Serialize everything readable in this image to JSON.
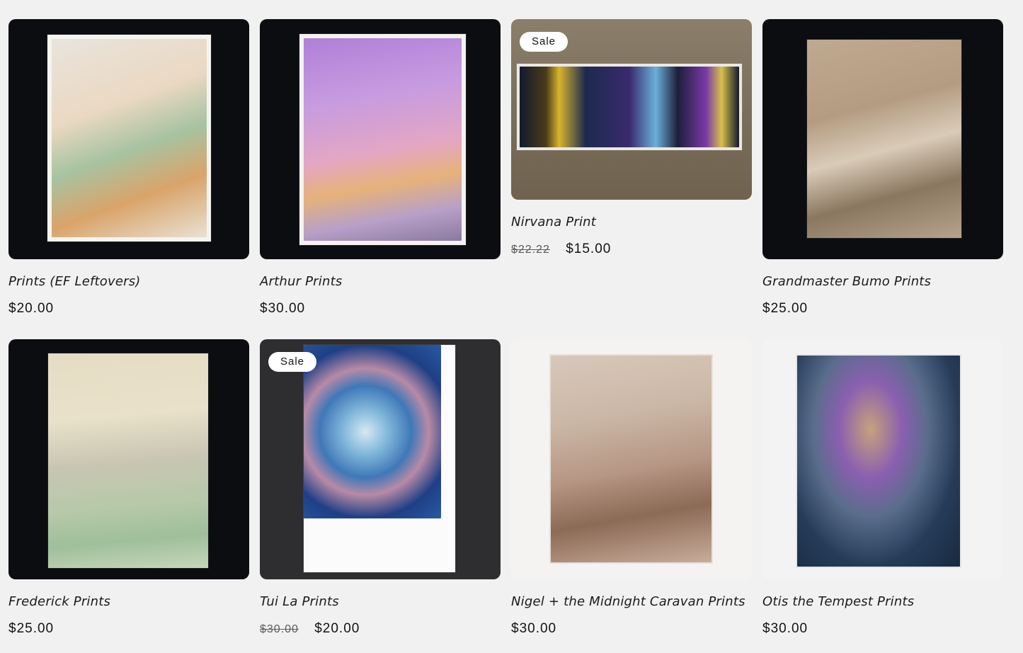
{
  "sale_badge": "Sale",
  "products": [
    {
      "title": "Prints (EF Leftovers)",
      "price": "$20.00",
      "compare_price": "",
      "on_sale": false,
      "bg": "#0c0d10",
      "mat": "#f6f4ef",
      "art": [
        "#e9d9c8",
        "#a7c3a1",
        "#d9a46a",
        "#7a6b6e"
      ]
    },
    {
      "title": "Arthur Prints",
      "price": "$30.00",
      "compare_price": "",
      "on_sale": false,
      "bg": "#0b0c10",
      "mat": "#f4f2f0",
      "art": [
        "#c79be0",
        "#a66fd0",
        "#e6b27a",
        "#7a4b2a"
      ]
    },
    {
      "title": "Nirvana Print",
      "price": "$15.00",
      "compare_price": "$22.22",
      "on_sale": true,
      "bg": "#867966",
      "mat": "#e9e6e3",
      "art": [
        "#0f1733",
        "#3a2a6e",
        "#d8b42e",
        "#6bb0d9"
      ]
    },
    {
      "title": "Grandmaster Bumo Prints",
      "price": "$25.00",
      "compare_price": "",
      "on_sale": false,
      "bg": "#0a0b0e",
      "mat": "#cdb59b",
      "art": [
        "#b49c82",
        "#8a775f",
        "#e2d4c2",
        "#4b3d31"
      ]
    },
    {
      "title": "Frederick Prints",
      "price": "$25.00",
      "compare_price": "",
      "on_sale": false,
      "bg": "#0a0c0e",
      "mat": "#dcd6c8",
      "art": [
        "#e2dcc6",
        "#a9c4a9",
        "#c49ac8",
        "#7e5d49"
      ]
    },
    {
      "title": "Tui La Prints",
      "price": "$20.00",
      "compare_price": "$30.00",
      "on_sale": true,
      "bg": "#2d2d2e",
      "mat": "#fbfbfb",
      "art": [
        "#1e3f86",
        "#4a9bd1",
        "#d7e9f2",
        "#b46a3a"
      ]
    },
    {
      "title": "Nigel + the Midnight Caravan Prints",
      "price": "$30.00",
      "compare_price": "",
      "on_sale": false,
      "bg": "#f2f2f2",
      "mat": "#e4d8cf",
      "art": [
        "#d7c4b6",
        "#b69684",
        "#8c6a56",
        "#efe6de"
      ]
    },
    {
      "title": "Otis the Tempest Prints",
      "price": "$30.00",
      "compare_price": "",
      "on_sale": false,
      "bg": "#f3f3f3",
      "mat": "#e8e8e8",
      "art": [
        "#253c59",
        "#5a6d8c",
        "#c7a27b",
        "#8a5fb0"
      ]
    }
  ]
}
